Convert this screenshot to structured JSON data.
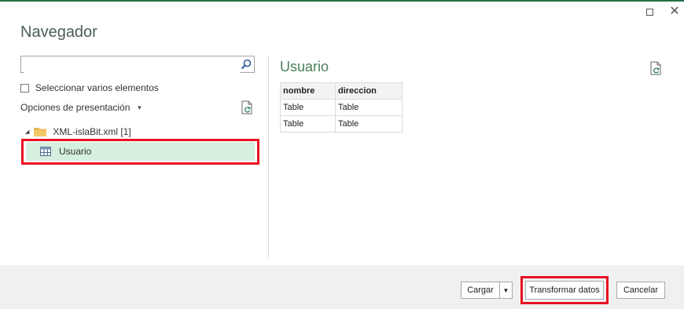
{
  "window": {
    "title": "Navegador",
    "maximize_icon": "maximize-icon",
    "close_icon": "close-icon",
    "close_glyph": "✕"
  },
  "left": {
    "search": {
      "value": "",
      "placeholder": ""
    },
    "multi_select_label": "Seleccionar varios elementos",
    "display_options_label": "Opciones de presentación",
    "tree": {
      "root_label": "XML-islaBit.xml [1]",
      "children": [
        {
          "label": "Usuario",
          "selected": true
        }
      ]
    }
  },
  "preview": {
    "title": "Usuario",
    "columns": [
      "nombre",
      "direccion"
    ],
    "rows": [
      [
        "Table",
        "Table"
      ],
      [
        "Table",
        "Table"
      ]
    ]
  },
  "footer": {
    "load_label": "Cargar",
    "transform_label": "Transformar datos",
    "cancel_label": "Cancelar"
  },
  "colors": {
    "accent": "#217346",
    "selection": "#d5f0de",
    "highlight": "#e81123"
  }
}
